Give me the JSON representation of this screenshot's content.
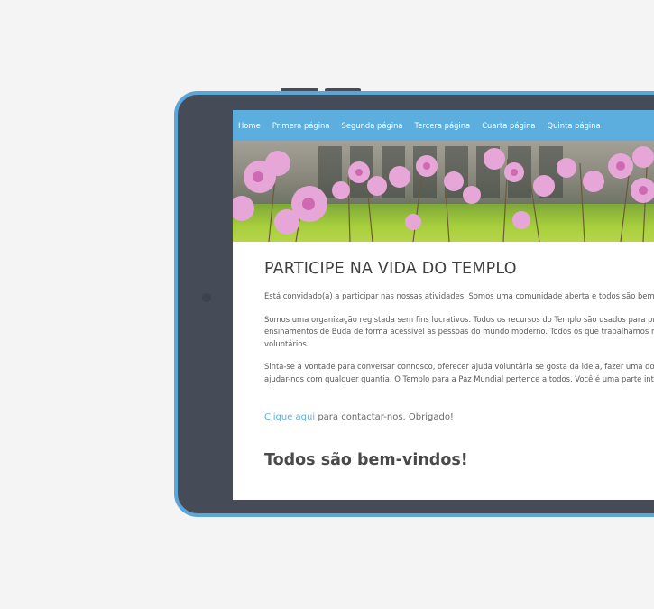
{
  "nav": {
    "items": [
      {
        "label": "Home"
      },
      {
        "label": "Primera página"
      },
      {
        "label": "Segunda página"
      },
      {
        "label": "Tercera página"
      },
      {
        "label": "Cuarta página"
      },
      {
        "label": "Quinta página"
      }
    ]
  },
  "hero": {
    "image_subject": "pink-tulbaghia-flowers-photo"
  },
  "main": {
    "title": "PARTICIPE NA VIDA DO TEMPLO",
    "paragraphs": [
      [
        "Está convidado(a) a participar nas nossas atividades. Somos uma comunidade aberta e todos são bem-v"
      ],
      [
        "Somos uma organização registada sem fins lucrativos. Todos os recursos do Templo são usados para pr",
        "ensinamentos de Buda de forma acessível às pessoas do mundo moderno. Todos os que trabalhamos n",
        "voluntários."
      ],
      [
        "Sinta-se à vontade para conversar connosco, oferecer ajuda voluntária se gosta da ideia, fazer uma doaç",
        "ajudar-nos com qualquer quantia. O Templo para a Paz Mundial pertence a todos. Você é uma parte inte"
      ]
    ],
    "contact_link": "Clique aqui",
    "contact_text": " para contactar-nos. Obrigado!",
    "welcome": "Todos são bem-vindos!"
  },
  "colors": {
    "frame_accent": "#5ba6d8",
    "frame_body": "#454c57",
    "nav_bg": "#5caede",
    "link": "#5caede",
    "background": "#f4f4f4"
  }
}
